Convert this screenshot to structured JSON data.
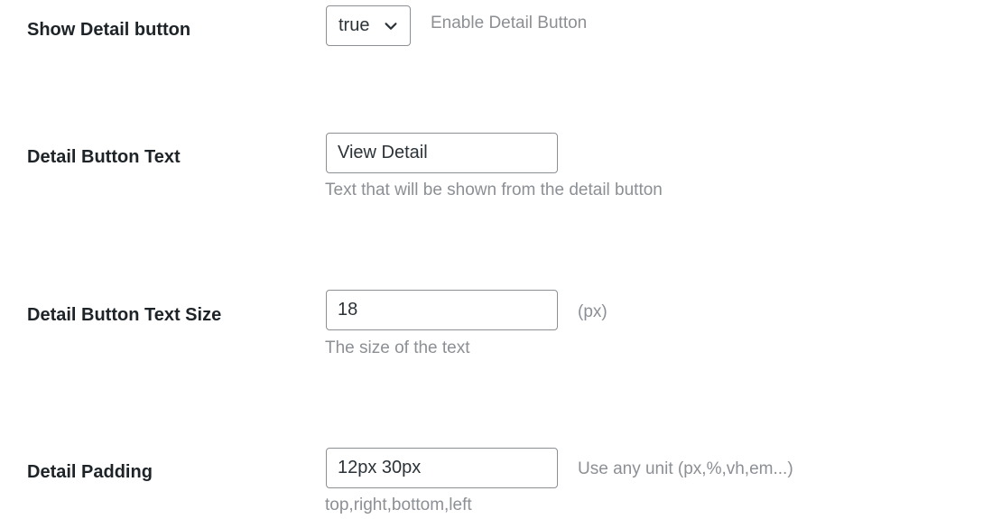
{
  "settings": {
    "show_detail": {
      "label": "Show Detail button",
      "value": "true",
      "hint": "Enable Detail Button"
    },
    "button_text": {
      "label": "Detail Button Text",
      "value": "View Detail",
      "description": "Text that will be shown from the detail button"
    },
    "text_size": {
      "label": "Detail Button Text Size",
      "value": "18",
      "unit": "(px)",
      "description": "The size of the text"
    },
    "padding": {
      "label": "Detail Padding",
      "value": "12px 30px",
      "hint": "Use any unit (px,%,vh,em...)",
      "description": "top,right,bottom,left"
    }
  },
  "icons": {
    "select_arrow": "chevron-down-icon"
  },
  "colors": {
    "label": "#1d2327",
    "hint": "#8c8f94",
    "border": "#8c8f94"
  }
}
